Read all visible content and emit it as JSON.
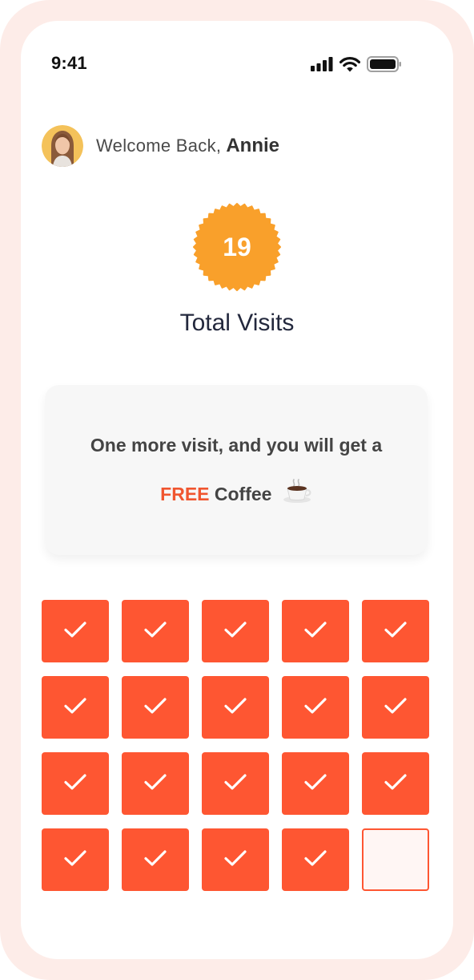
{
  "status_bar": {
    "time": "9:41"
  },
  "header": {
    "greeting": "Welcome Back,",
    "user_name": "Annie"
  },
  "visits": {
    "count": "19",
    "label": "Total Visits"
  },
  "promo": {
    "line1": "One more visit, and you will get a",
    "free_word": "FREE",
    "reward_word": "Coffee"
  },
  "stamp_card": {
    "total_slots": 20,
    "filled": 19,
    "slots": [
      true,
      true,
      true,
      true,
      true,
      true,
      true,
      true,
      true,
      true,
      true,
      true,
      true,
      true,
      true,
      true,
      true,
      true,
      true,
      false
    ]
  },
  "colors": {
    "accent": "#fe5632",
    "badge": "#f9a02b",
    "frame": "#fdece8"
  },
  "icons": [
    "signal-icon",
    "wifi-icon",
    "battery-icon",
    "checkmark-icon",
    "coffee-cup-icon"
  ]
}
